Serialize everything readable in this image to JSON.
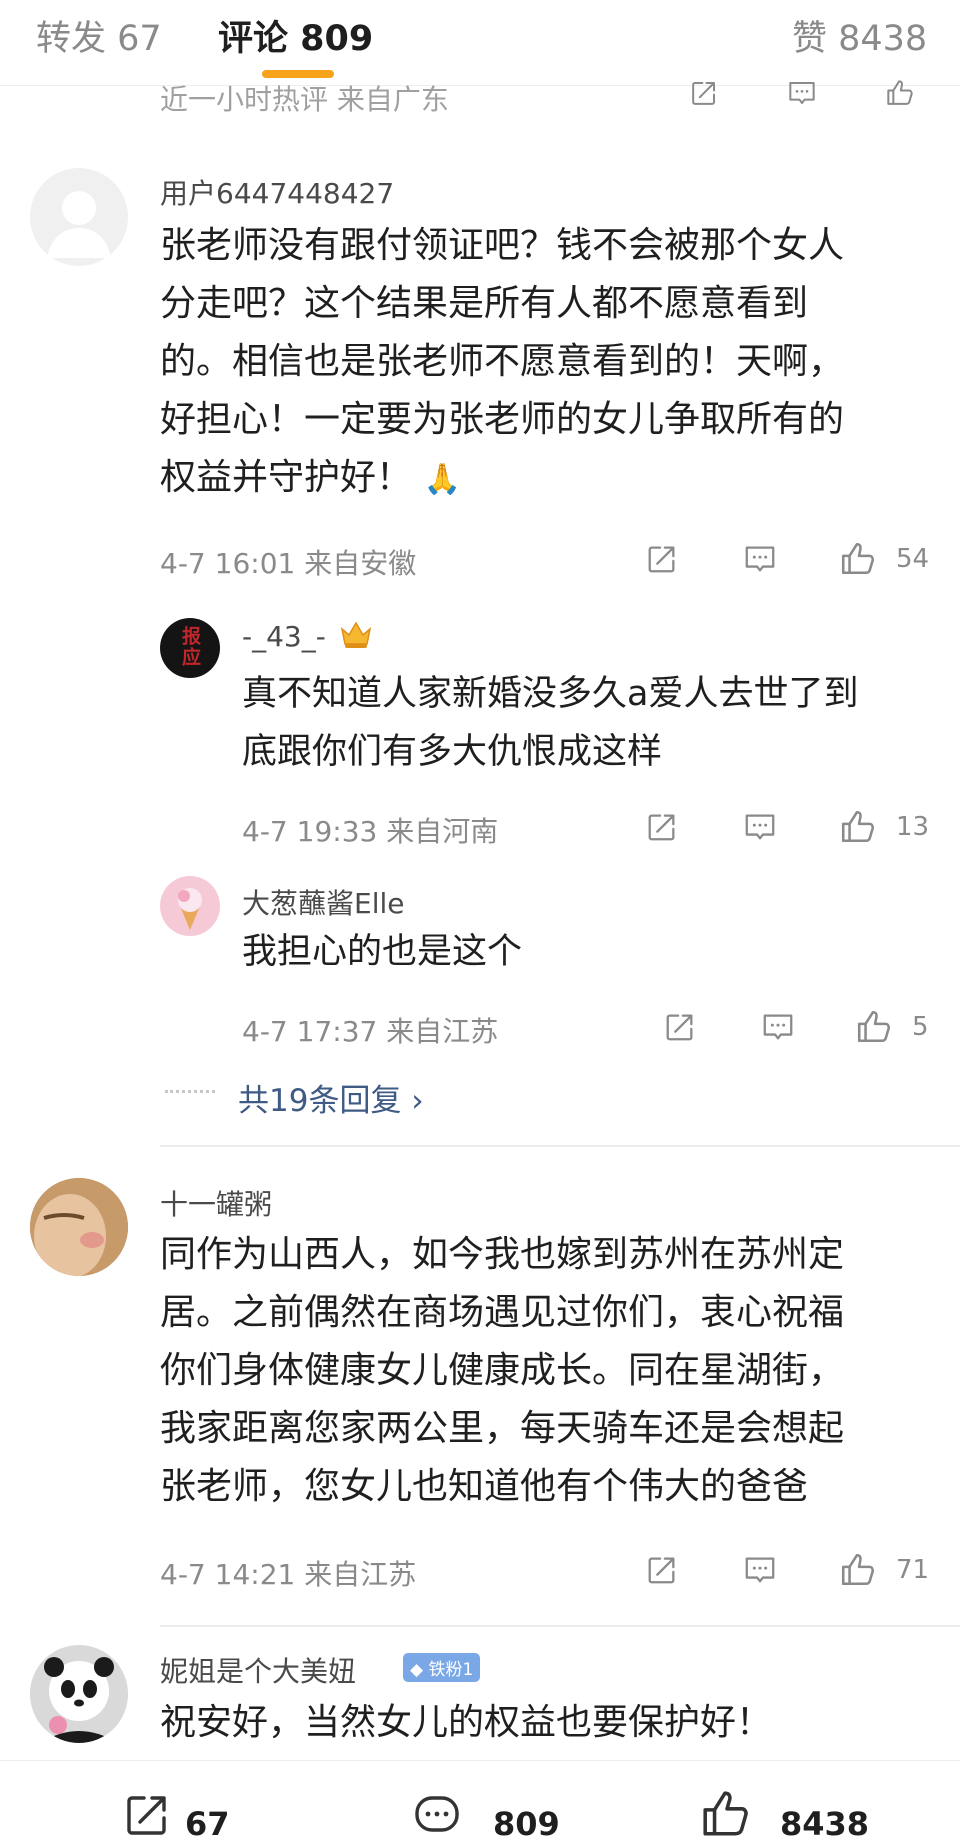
{
  "tabs": {
    "repost": "转发 67",
    "comments": "评论 809",
    "likes": "赞 8438"
  },
  "top_comment_meta": "近一小时热评 来自广东",
  "comment1": {
    "username": "用户6447448427",
    "text": "张老师没有跟付领证吧？钱不会被那个女人\n分走吧？这个结果是所有人都不愿意看到\n的。相信也是张老师不愿意看到的！天啊，\n好担心！一定要为张老师的女儿争取所有的\n权益并守护好！",
    "emoji": "🙏",
    "time": "4-7 16:01 来自安徽",
    "likes": "54"
  },
  "reply1": {
    "username": "-_43_-",
    "avatar_text": "报应",
    "text": "真不知道人家新婚没多久a爱人去世了到\n底跟你们有多大仇恨成这样",
    "time": "4-7 19:33 来自河南",
    "likes": "13"
  },
  "reply2": {
    "username": "大葱蘸酱Elle",
    "text": "我担心的也是这个",
    "time": "4-7 17:37 来自江苏",
    "likes": "5"
  },
  "more_replies": "共19条回复 ›",
  "comment2": {
    "username": "十一罐粥",
    "text": "同作为山西人，如今我也嫁到苏州在苏州定\n居。之前偶然在商场遇见过你们，衷心祝福\n你们身体健康女儿健康成长。同在星湖街，\n我家距离您家两公里，每天骑车还是会想起\n张老师，您女儿也知道他有个伟大的爸爸",
    "time": "4-7 14:21 来自江苏",
    "likes": "71"
  },
  "comment3": {
    "username": "妮姐是个大美妞",
    "badge": "铁粉1",
    "text": "祝安好，当然女儿的权益也要保护好！"
  },
  "bottom_bar": {
    "repost_count": "67",
    "comment_count": "809",
    "like_count": "8438"
  },
  "colors": {
    "accent": "#f7a21b",
    "link": "#3f5a84",
    "badge": "#7aa8e6"
  }
}
